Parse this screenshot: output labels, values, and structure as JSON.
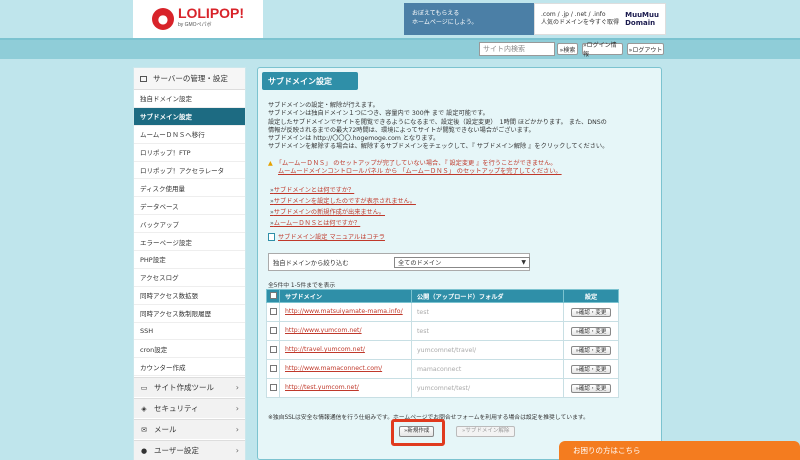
{
  "header": {
    "logo_text": "LOLIPOP!",
    "logo_sub": "by GMOペパボ",
    "banner": {
      "left_line1": "おぼえてもらえる",
      "left_line2": "ホームページにしよう。",
      "domains": ".com / .jp / .net / .info",
      "domains_sub": "人気のドメインを今すぐ取得",
      "brand": "MuuMuu",
      "brand2": "Domain"
    }
  },
  "navbar": {
    "search_placeholder": "サイト内検索",
    "search_button": "»検索",
    "login_info_button": "»ログイン情報",
    "logout_button": "»ログアウト"
  },
  "sidebar": {
    "section_title": "サーバーの管理・設定",
    "items": [
      {
        "label": "独自ドメイン設定"
      },
      {
        "label": "サブドメイン設定",
        "active": true
      },
      {
        "label": "ムームーＤＮＳへ移行"
      },
      {
        "label": "ロリポップ！FTP"
      },
      {
        "label": "ロリポップ！アクセラレータ"
      },
      {
        "label": "ディスク使用量"
      },
      {
        "label": "データベース"
      },
      {
        "label": "バックアップ"
      },
      {
        "label": "エラーページ設定"
      },
      {
        "label": "PHP設定"
      },
      {
        "label": "アクセスログ"
      },
      {
        "label": "同時アクセス数拡張"
      },
      {
        "label": "同時アクセス数制限履歴"
      },
      {
        "label": "SSH"
      },
      {
        "label": "cron設定"
      },
      {
        "label": "カウンター作成"
      }
    ],
    "categories": [
      {
        "label": "サイト作成ツール"
      },
      {
        "label": "セキュリティ"
      },
      {
        "label": "メール"
      },
      {
        "label": "ユーザー設定"
      }
    ]
  },
  "main": {
    "title": "サブドメイン設定",
    "description": [
      "サブドメインの設定・解除が行えます。",
      "サブドメインは独自ドメイン１つにつき、容量内で 300件 まで 設定可能です。",
      "設定したサブドメインでサイトを閲覧できるようになるまで、設定後（設定変更）　1時間 ほどかかります。 また、DNSの",
      "情報が反映されるまでの最大72時間は、環境によってサイトが閲覧できない場合がございます。",
      "サブドメインは http://〇〇〇.hogemoge.com となります。",
      "サブドメインを解除する場合は、解除するサブドメインをチェックして、『 サブドメイン解除 』をクリックしてください。"
    ],
    "warning": [
      "「ムームーＤＮＳ」 のセットアップが完了していない場合、『 設定変更 』を行うことができません。",
      "ムームードメインコントロールパネル から 「ムームーＤＮＳ」 のセットアップを完了してください。"
    ],
    "faq": [
      "サブドメインとは何ですか？",
      "サブドメインを設定したのですが表示されません。",
      "サブドメインの新規作成が出来ません。",
      "ムームーＤＮＳとは何ですか？"
    ],
    "manual_link": "サブドメイン設定 マニュアルはコチラ",
    "filter": {
      "label": "独自ドメインから絞り込む",
      "selected": "全てのドメイン"
    },
    "count_text": "全5件中 1-5件までを表示",
    "table": {
      "headers": [
        "サブドメイン",
        "公開（アップロード）フォルダ",
        "設定"
      ],
      "rows": [
        {
          "domain": "http://www.matsuiyamate-mama.info/",
          "folder": "test",
          "action": "»確認・変更"
        },
        {
          "domain": "http://www.yumcom.net/",
          "folder": "test",
          "action": "»確認・変更"
        },
        {
          "domain": "http://travel.yumcom.net/",
          "folder": "yumcomnet/travel/",
          "action": "»確認・変更"
        },
        {
          "domain": "http://www.mamaconnect.com/",
          "folder": "mamaconnect",
          "action": "»確認・変更"
        },
        {
          "domain": "http://test.yumcom.net/",
          "folder": "yumcomnet/test/",
          "action": "»確認・変更"
        }
      ]
    },
    "note": "※独自SSLは安全な情報通信を行う仕組みです。ホームページでお問合せフォームを利用する場合は設定を推奨しています。",
    "new_button": "»新規作成",
    "delete_button": "»サブドメイン解除"
  },
  "help_tab": "お困りの方はこちら",
  "colors": {
    "accent": "#2f8fa8",
    "active": "#1d6b82",
    "link": "#c0392b",
    "highlight": "#e03a1e",
    "help": "#f47c1f"
  }
}
